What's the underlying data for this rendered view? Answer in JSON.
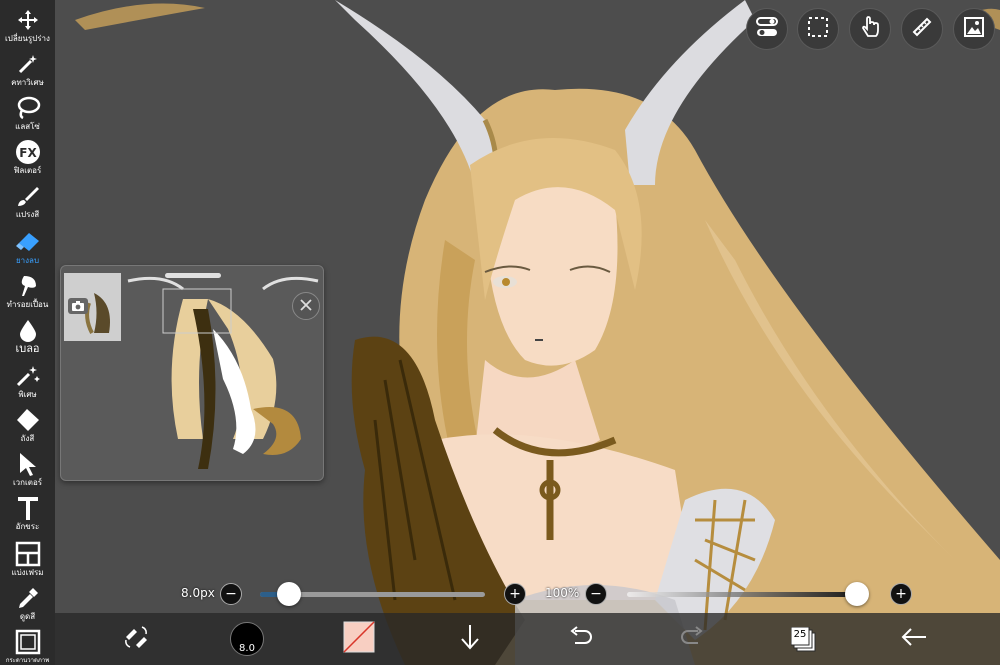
{
  "toolbar": {
    "tools": [
      {
        "id": "transform",
        "label": "เปลี่ยนรูปร่าง",
        "icon": "move-arrows-icon",
        "active": false
      },
      {
        "id": "magic",
        "label": "คทาวิเศษ",
        "icon": "magic-wand-icon",
        "active": false
      },
      {
        "id": "lasso",
        "label": "แลสโซ่",
        "icon": "lasso-icon",
        "active": false
      },
      {
        "id": "filter",
        "label": "ฟิลเตอร์",
        "icon": "fx-icon",
        "active": false
      },
      {
        "id": "brush",
        "label": "แปรงสี",
        "icon": "brush-icon",
        "active": false
      },
      {
        "id": "eraser",
        "label": "ยางลบ",
        "icon": "eraser-icon",
        "active": true
      },
      {
        "id": "smudge",
        "label": "ทำรอยเปื้อน",
        "icon": "smudge-icon",
        "active": false
      },
      {
        "id": "blur",
        "label": "เบลอ",
        "icon": "blur-drop-icon",
        "active": false
      },
      {
        "id": "special",
        "label": "พิเศษ",
        "icon": "sparkle-wand-icon",
        "active": false
      },
      {
        "id": "bucket",
        "label": "ถังสี",
        "icon": "paint-bucket-icon",
        "active": false
      },
      {
        "id": "vector",
        "label": "เวกเตอร์",
        "icon": "cursor-arrow-icon",
        "active": false
      },
      {
        "id": "text",
        "label": "อักขระ",
        "icon": "text-icon",
        "active": false
      },
      {
        "id": "frame",
        "label": "แบ่งเฟรม",
        "icon": "frame-divider-icon",
        "active": false
      },
      {
        "id": "eyedropper",
        "label": "ดูดสี",
        "icon": "eyedropper-icon",
        "active": false
      },
      {
        "id": "canvas",
        "label": "กระดานวาดภาพ",
        "icon": "canvas-icon",
        "active": false
      }
    ]
  },
  "top_buttons": [
    {
      "id": "toggle",
      "icon": "toggle-settings-icon"
    },
    {
      "id": "selection",
      "icon": "selection-rect-icon"
    },
    {
      "id": "hand",
      "icon": "hand-touch-icon"
    },
    {
      "id": "ruler",
      "icon": "ruler-icon"
    },
    {
      "id": "gallery",
      "icon": "image-gallery-icon"
    }
  ],
  "sliders": {
    "size_value": "8.0px",
    "size_fraction": 0.13,
    "opacity_value": "100%",
    "opacity_fraction": 1.0
  },
  "bottombar": {
    "brush_size_label": "8.0",
    "layer_count": "25"
  },
  "colors": {
    "active_tool": "#39a0ff",
    "toolbar_bg": "#2b2b2b",
    "canvas_bg": "#4d4d4d",
    "size_track": "#2d5f8a"
  }
}
